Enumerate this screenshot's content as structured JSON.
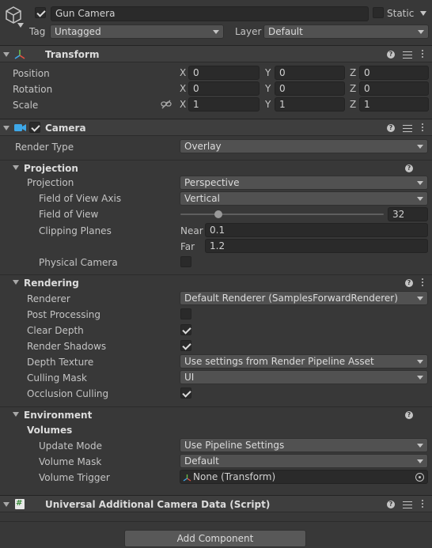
{
  "object": {
    "name": "Gun Camera",
    "static_label": "Static",
    "tag_label": "Tag",
    "tag_value": "Untagged",
    "layer_label": "Layer",
    "layer_value": "Default"
  },
  "transform": {
    "title": "Transform",
    "position_label": "Position",
    "rotation_label": "Rotation",
    "scale_label": "Scale",
    "axis_x": "X",
    "axis_y": "Y",
    "axis_z": "Z",
    "position": [
      "0",
      "0",
      "0"
    ],
    "rotation": [
      "0",
      "0",
      "0"
    ],
    "scale": [
      "1",
      "1",
      "1"
    ]
  },
  "camera": {
    "title": "Camera",
    "render_type_label": "Render Type",
    "render_type_value": "Overlay",
    "projection": {
      "title": "Projection",
      "projection_label": "Projection",
      "projection_value": "Perspective",
      "fov_axis_label": "Field of View Axis",
      "fov_axis_value": "Vertical",
      "fov_label": "Field of View",
      "fov_value": "32",
      "clipping_label": "Clipping Planes",
      "near_label": "Near",
      "near_value": "0.1",
      "far_label": "Far",
      "far_value": "1.2",
      "physical_label": "Physical Camera"
    },
    "rendering": {
      "title": "Rendering",
      "renderer_label": "Renderer",
      "renderer_value": "Default Renderer (SamplesForwardRenderer)",
      "post_label": "Post Processing",
      "clear_depth_label": "Clear Depth",
      "shadows_label": "Render Shadows",
      "depth_tex_label": "Depth Texture",
      "depth_tex_value": "Use settings from Render Pipeline Asset",
      "culling_label": "Culling Mask",
      "culling_value": "UI",
      "occlusion_label": "Occlusion Culling"
    },
    "environment": {
      "title": "Environment",
      "volumes_label": "Volumes",
      "update_mode_label": "Update Mode",
      "update_mode_value": "Use Pipeline Settings",
      "volume_mask_label": "Volume Mask",
      "volume_mask_value": "Default",
      "volume_trigger_label": "Volume Trigger",
      "volume_trigger_value": "None (Transform)"
    }
  },
  "script_component": {
    "title": "Universal Additional Camera Data (Script)"
  },
  "add_component_label": "Add Component",
  "colors": {
    "background": "#383838",
    "header": "#3e3e3e",
    "field": "#2a2a2a",
    "dropdown": "#515151",
    "camera_icon": "#3ea8e8",
    "script_icon": "#4caf50"
  }
}
